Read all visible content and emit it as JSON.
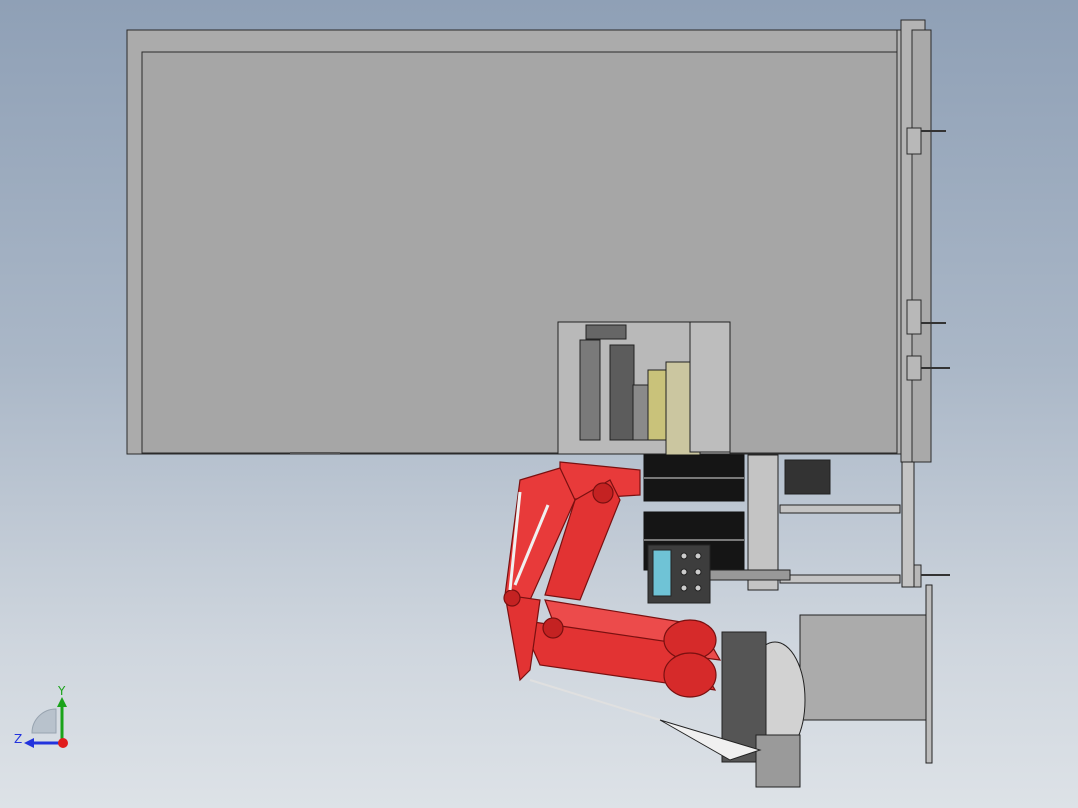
{
  "triad": {
    "y_label": "Y",
    "z_label": "Z",
    "x_color": "#e01c1c",
    "y_color": "#1aa31a",
    "z_color": "#2233dd"
  },
  "colors": {
    "panel": "#a8a8a8",
    "panel_edge": "#2b2b2b",
    "robot": "#e83a3a",
    "robot_dark": "#b51f1f",
    "machine": "#bdbdbd",
    "cable": "#f0f0f0",
    "fixture_yellow": "#c9c27a",
    "screen": "#6fc3d6"
  }
}
